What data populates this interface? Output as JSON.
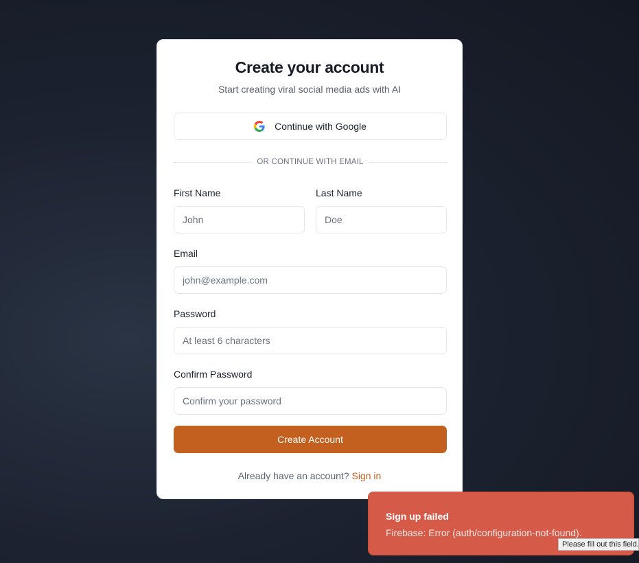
{
  "form": {
    "title": "Create your account",
    "subtitle": "Start creating viral social media ads with AI",
    "google_button_label": "Continue with Google",
    "google_icon": "google-g-icon",
    "divider_text": "OR CONTINUE WITH EMAIL",
    "first_name": {
      "label": "First Name",
      "placeholder": "John",
      "value": ""
    },
    "last_name": {
      "label": "Last Name",
      "placeholder": "Doe",
      "value": ""
    },
    "email": {
      "label": "Email",
      "placeholder": "john@example.com",
      "value": ""
    },
    "password": {
      "label": "Password",
      "placeholder": "At least 6 characters",
      "value": ""
    },
    "confirm_password": {
      "label": "Confirm Password",
      "placeholder": "Confirm your password",
      "value": ""
    },
    "submit_label": "Create Account",
    "signin_prompt": "Already have an account?",
    "signin_link": "Sign in"
  },
  "toast": {
    "title": "Sign up failed",
    "message": "Firebase: Error (auth/configuration-not-found)."
  },
  "tooltip": {
    "text": "Please fill out this field."
  },
  "colors": {
    "accent": "#c4601f",
    "toast_bg": "#d65a48",
    "background": "#1c2230"
  }
}
